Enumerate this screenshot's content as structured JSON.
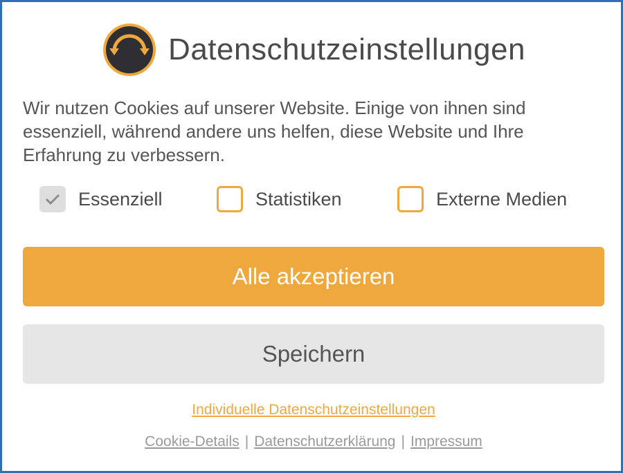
{
  "dialog": {
    "title": "Datenschutzeinstellungen",
    "logo_icon": "refresh-arrows-icon",
    "intro_text": "Wir nutzen Cookies auf unserer Website. Einige von ihnen sind essenziell, während andere uns helfen, diese Website und Ihre Erfahrung zu verbessern."
  },
  "options": [
    {
      "label": "Essenziell",
      "checked": true,
      "disabled": true
    },
    {
      "label": "Statistiken",
      "checked": false,
      "disabled": false
    },
    {
      "label": "Externe Medien",
      "checked": false,
      "disabled": false
    }
  ],
  "buttons": {
    "accept_all": "Alle akzeptieren",
    "save": "Speichern"
  },
  "links": {
    "individual_settings": "Individuelle Datenschutzeinstellungen",
    "footer": [
      "Cookie-Details",
      "Datenschutzerklärung",
      "Impressum"
    ],
    "separator": "|"
  },
  "colors": {
    "accent": "#eea83d",
    "border": "#2f6fb5",
    "text": "#555555",
    "logo_bg": "#2e2e33"
  }
}
